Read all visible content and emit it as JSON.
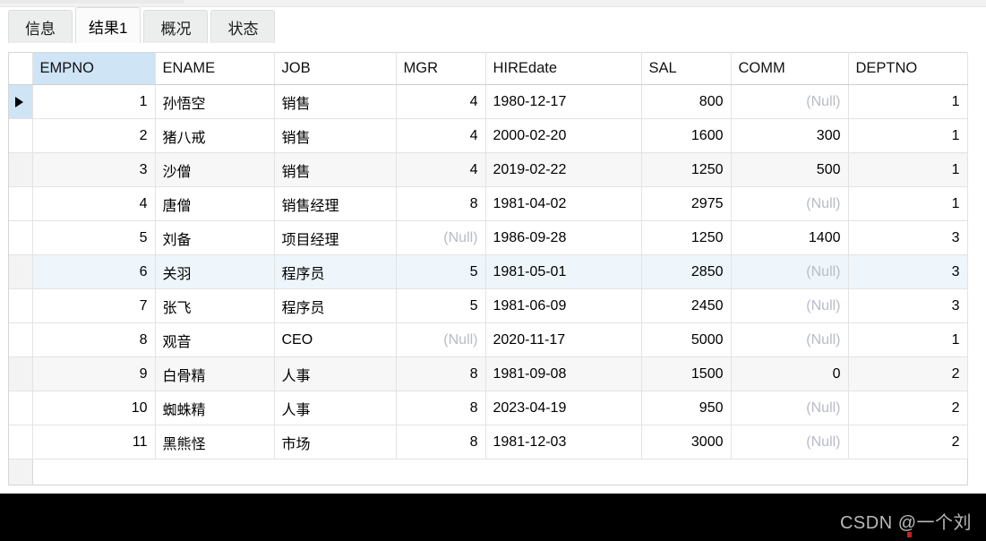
{
  "window": {
    "tabs": [
      {
        "label": "信息",
        "active": false
      },
      {
        "label": "结果1",
        "active": true
      },
      {
        "label": "概况",
        "active": false
      },
      {
        "label": "状态",
        "active": false
      }
    ]
  },
  "grid": {
    "selected_column": "EMPNO",
    "current_row_index": 1,
    "highlight_row_index": 6,
    "null_label": "(Null)",
    "columns": [
      {
        "key": "EMPNO",
        "label": "EMPNO",
        "align": "right"
      },
      {
        "key": "ENAME",
        "label": "ENAME",
        "align": "left"
      },
      {
        "key": "JOB",
        "label": "JOB",
        "align": "left"
      },
      {
        "key": "MGR",
        "label": "MGR",
        "align": "right"
      },
      {
        "key": "HIREdate",
        "label": "HIREdate",
        "align": "left"
      },
      {
        "key": "SAL",
        "label": "SAL",
        "align": "right"
      },
      {
        "key": "COMM",
        "label": "COMM",
        "align": "right"
      },
      {
        "key": "DEPTNO",
        "label": "DEPTNO",
        "align": "right"
      }
    ],
    "rows": [
      {
        "EMPNO": "1",
        "ENAME": "孙悟空",
        "JOB": "销售",
        "MGR": null,
        "HIREdate": "1980-12-17",
        "SAL": "800",
        "COMM": null,
        "DEPTNO": "1"
      },
      {
        "EMPNO": "2",
        "ENAME": "猪八戒",
        "JOB": "销售",
        "MGR": "4",
        "HIREdate": "2000-02-20",
        "SAL": "1600",
        "COMM": "300",
        "DEPTNO": "1"
      },
      {
        "EMPNO": "3",
        "ENAME": "沙僧",
        "JOB": "销售",
        "MGR": "4",
        "HIREdate": "2019-02-22",
        "SAL": "1250",
        "COMM": "500",
        "DEPTNO": "1"
      },
      {
        "EMPNO": "4",
        "ENAME": "唐僧",
        "JOB": "销售经理",
        "MGR": "8",
        "HIREdate": "1981-04-02",
        "SAL": "2975",
        "COMM": null,
        "DEPTNO": "1"
      },
      {
        "EMPNO": "5",
        "ENAME": "刘备",
        "JOB": "项目经理",
        "MGR": null,
        "HIREdate": "1986-09-28",
        "SAL": "1250",
        "COMM": "1400",
        "DEPTNO": "3"
      },
      {
        "EMPNO": "6",
        "ENAME": "关羽",
        "JOB": "程序员",
        "MGR": "5",
        "HIREdate": "1981-05-01",
        "SAL": "2850",
        "COMM": null,
        "DEPTNO": "3"
      },
      {
        "EMPNO": "7",
        "ENAME": "张飞",
        "JOB": "程序员",
        "MGR": "5",
        "HIREdate": "1981-06-09",
        "SAL": "2450",
        "COMM": null,
        "DEPTNO": "3"
      },
      {
        "EMPNO": "8",
        "ENAME": "观音",
        "JOB": "CEO",
        "MGR": null,
        "HIREdate": "2020-11-17",
        "SAL": "5000",
        "COMM": null,
        "DEPTNO": "1"
      },
      {
        "EMPNO": "9",
        "ENAME": "白骨精",
        "JOB": "人事",
        "MGR": "8",
        "HIREdate": "1981-09-08",
        "SAL": "1500",
        "COMM": "0",
        "DEPTNO": "2"
      },
      {
        "EMPNO": "10",
        "ENAME": "蜘蛛精",
        "JOB": "人事",
        "MGR": "8",
        "HIREdate": "2023-04-19",
        "SAL": "950",
        "COMM": null,
        "DEPTNO": "2"
      },
      {
        "EMPNO": "11",
        "ENAME": "黑熊怪",
        "JOB": "市场",
        "MGR": "8",
        "HIREdate": "1981-12-03",
        "SAL": "3000",
        "COMM": null,
        "DEPTNO": "2"
      }
    ],
    "mgr_overrides": {
      "1": "4"
    }
  },
  "watermark": {
    "text": "CSDN @一个刘"
  },
  "colors": {
    "selection_blue": "#cfe4f5",
    "row_highlight": "#eef6fc",
    "stripe": "#f7f7f7",
    "null_text": "#b9bcc6",
    "grid_line": "#e3e3e3",
    "band": "#000000",
    "watermark_text": "#b9b9b9",
    "watermark_dot": "#cc2121"
  }
}
